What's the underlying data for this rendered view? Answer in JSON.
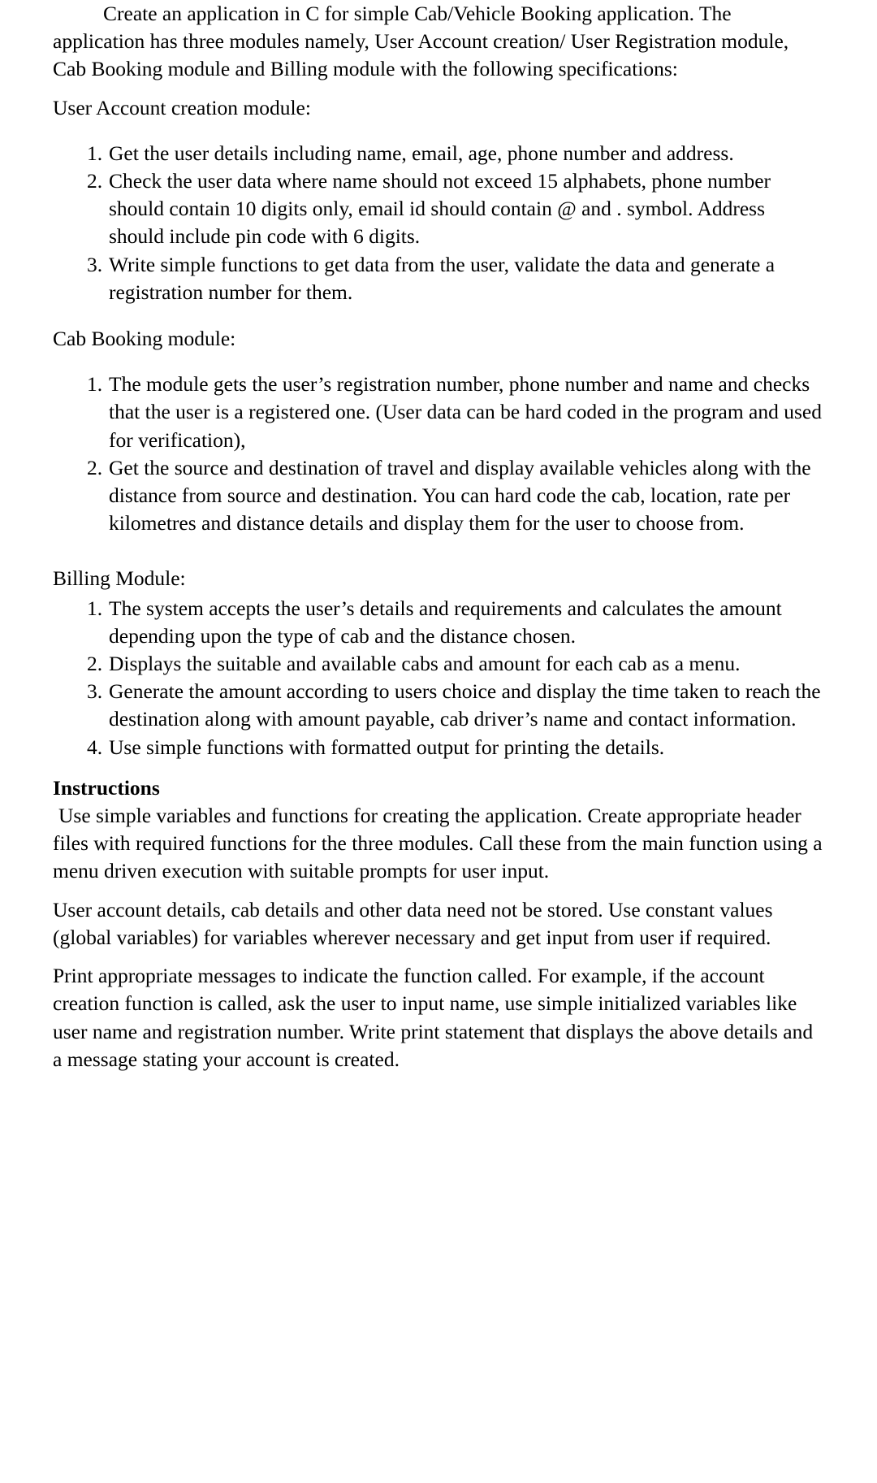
{
  "document": {
    "intro": {
      "text": "Create an application in C for simple Cab/Vehicle Booking application. The application has three modules namely, User Account creation/ User Registration module, Cab Booking module and Billing module with the following specifications:"
    },
    "sections": [
      {
        "heading": "User Account creation module:",
        "items": [
          "Get the user details including name, email, age, phone number and address.",
          "Check the user data where name should not exceed 15 alphabets, phone number should contain 10 digits only, email id should contain @ and . symbol. Address should include pin code with 6 digits.",
          "Write simple functions to get data from the user, validate the data and generate a registration number for them."
        ]
      },
      {
        "heading": "Cab Booking module:",
        "items": [
          "The module gets the user’s registration number, phone number and name and checks that the user is a registered one. (User data can be hard coded in the program and used for verification),",
          "Get the source and destination of travel and display available vehicles along with the distance from source and destination. You can hard code the cab, location, rate per kilometres and distance details and display them for the user to choose from."
        ]
      },
      {
        "heading": "Billing Module:",
        "items": [
          "The system accepts the user’s details and requirements and calculates the amount depending upon the type of cab and the distance chosen.",
          "Displays the suitable and available cabs and amount for each cab as a menu.",
          "Generate the amount according to users choice and display the time taken to reach the destination along with amount payable, cab driver’s name and contact information.",
          "Use simple functions with formatted output for printing the details."
        ]
      }
    ],
    "instructions": {
      "heading": "Instructions",
      "paragraphs": [
        "Use simple variables and functions for creating the application. Create appropriate header files with required functions for the three modules. Call these from the main function using a menu driven execution with suitable prompts for user input.",
        "User account details, cab details and other data need not be stored. Use constant values (global variables) for variables wherever necessary and get input from user if required.",
        "Print appropriate messages to indicate the function called. For example, if the account creation function is called, ask the user to input name, use simple initialized variables like user name and registration number. Write print statement that displays the above details and a message stating your account is created."
      ]
    },
    "list_markers": {
      "m1": "1.",
      "m2": "2.",
      "m3": "3.",
      "m4": "4."
    }
  }
}
